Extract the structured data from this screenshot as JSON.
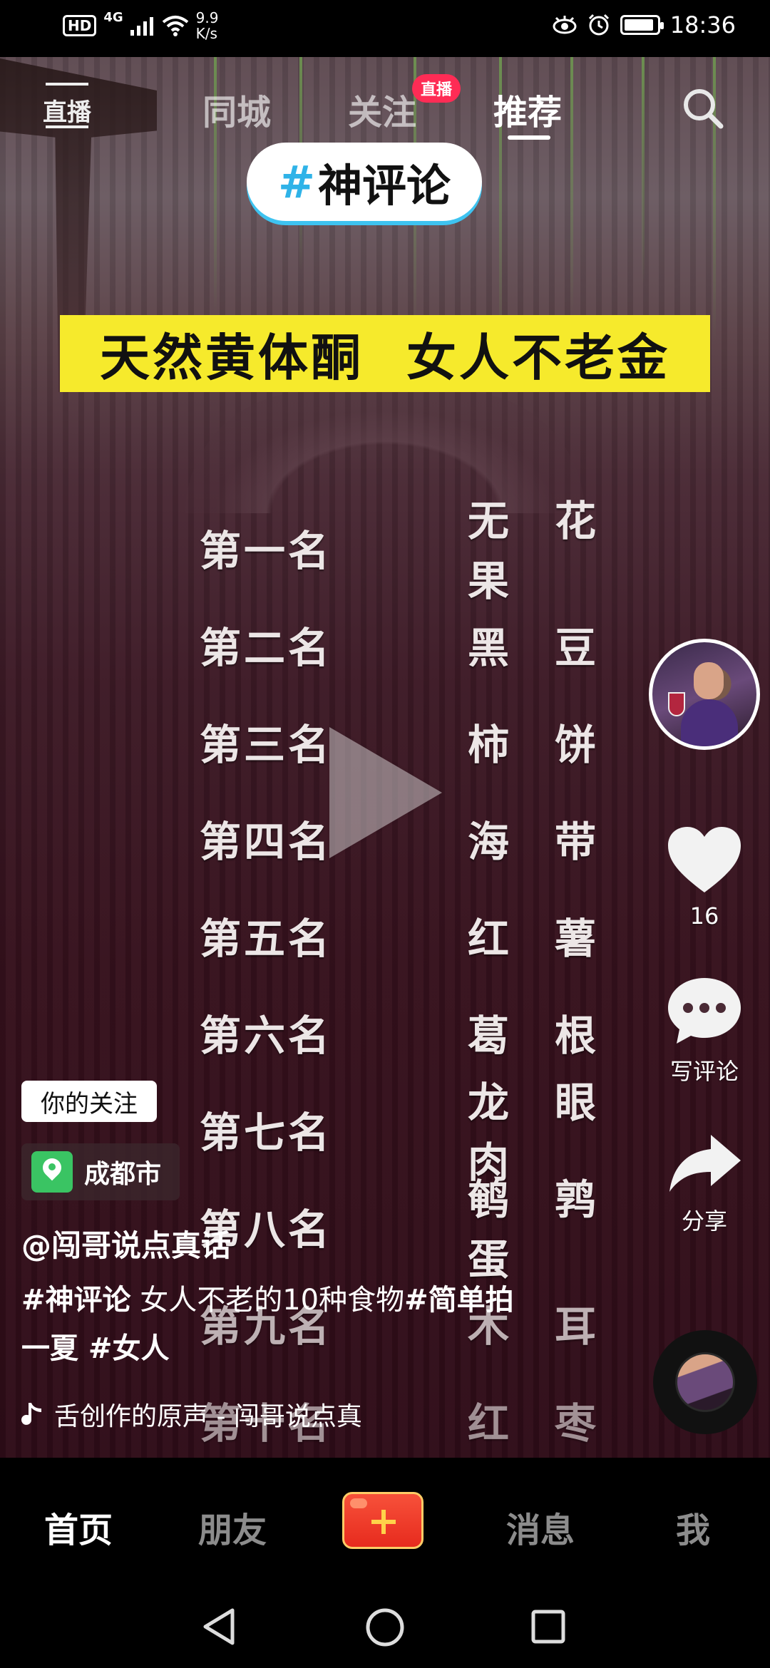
{
  "status_bar": {
    "network_hd": "HD",
    "network_type": "4G",
    "speed_value": "9.9",
    "speed_unit": "K/s",
    "time": "18:36",
    "battery_level": 0.9
  },
  "top_nav": {
    "live_label": "直播",
    "tabs": [
      {
        "label": "同城",
        "active": false
      },
      {
        "label": "关注",
        "active": false
      },
      {
        "label": "推荐",
        "active": true
      }
    ],
    "follow_badge": "直播",
    "icons": {
      "live": "live-icon",
      "search": "search-icon"
    }
  },
  "video": {
    "hashtag_symbol": "#",
    "hashtag": "神评论",
    "banner_left": "天然黄体酮",
    "banner_right": "女人不老金",
    "ranking": [
      {
        "rank": "第一名",
        "food": "无花果"
      },
      {
        "rank": "第二名",
        "food": "黑豆"
      },
      {
        "rank": "第三名",
        "food": "柿饼"
      },
      {
        "rank": "第四名",
        "food": "海带"
      },
      {
        "rank": "第五名",
        "food": "红薯"
      },
      {
        "rank": "第六名",
        "food": "葛根"
      },
      {
        "rank": "第七名",
        "food": "龙眼肉"
      },
      {
        "rank": "第八名",
        "food": "鹌鹑蛋"
      },
      {
        "rank": "第九名",
        "food": "木耳"
      },
      {
        "rank": "第十名",
        "food": "红枣"
      }
    ]
  },
  "right_rail": {
    "like_count": "16",
    "comment_label": "写评论",
    "share_label": "分享"
  },
  "info": {
    "follow_tag": "你的关注",
    "location": "成都市",
    "author": "@闯哥说点真话",
    "caption_tag1": "#神评论",
    "caption_text": " 女人不老的10种食物",
    "caption_tag2": "#简单拍一夏",
    "caption_tag3": " #女人",
    "music": "舌创作的原声 - 闯哥说点真"
  },
  "tab_bar": {
    "tabs": [
      {
        "label": "首页",
        "active": true
      },
      {
        "label": "朋友",
        "active": false
      },
      {
        "label": "消息",
        "active": false
      },
      {
        "label": "我",
        "active": false
      }
    ]
  },
  "colors": {
    "accent_red": "#fe2c55",
    "banner_yellow": "#f6ea2c",
    "hashtag_blue": "#2fb3e8",
    "location_green": "#3ac463"
  }
}
